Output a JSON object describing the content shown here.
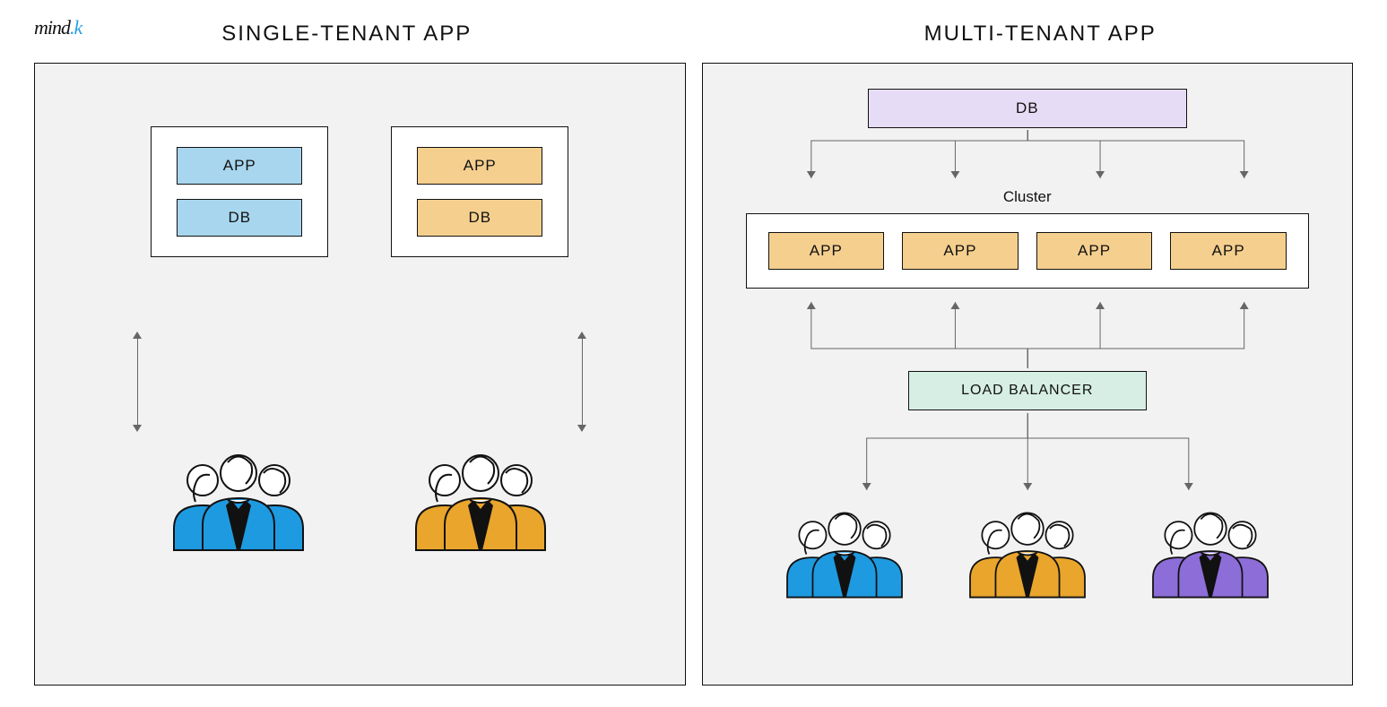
{
  "logo": {
    "brand": "mind",
    "accent": ".k"
  },
  "titles": {
    "left": "SINGLE-TENANT APP",
    "right": "MULTI-TENANT APP"
  },
  "single_tenant": {
    "stacks": [
      {
        "app_label": "APP",
        "db_label": "DB",
        "color": "blue"
      },
      {
        "app_label": "APP",
        "db_label": "DB",
        "color": "amber"
      }
    ],
    "tenants": [
      {
        "color": "blue"
      },
      {
        "color": "amber"
      }
    ]
  },
  "multi_tenant": {
    "db_label": "DB",
    "cluster_label": "Cluster",
    "apps": [
      {
        "label": "APP"
      },
      {
        "label": "APP"
      },
      {
        "label": "APP"
      },
      {
        "label": "APP"
      }
    ],
    "load_balancer_label": "LOAD BALANCER",
    "tenants": [
      {
        "color": "blue"
      },
      {
        "color": "amber"
      },
      {
        "color": "purple"
      }
    ]
  },
  "colors": {
    "blue": "#1e9ae0",
    "amber": "#e9a52c",
    "purple": "#8d6dd8",
    "box_blue": "#a8d6ef",
    "box_amber": "#f5cf8e",
    "box_lilac": "#e7dcf5",
    "box_mint": "#d6eee4"
  }
}
